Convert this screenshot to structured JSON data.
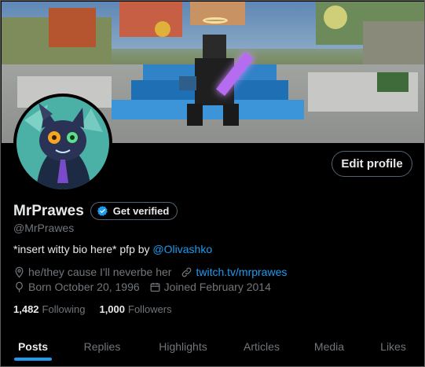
{
  "profile": {
    "edit_profile_label": "Edit profile",
    "display_name": "MrPrawes",
    "verify_label": "Get verified",
    "handle": "@MrPrawes",
    "bio_text": "*insert witty bio here* pfp by ",
    "bio_mention": "@Olivashko",
    "pronouns": "he/they cause I'll neverbe her",
    "website": "twitch.tv/mrprawes",
    "born": "Born October 20, 1996",
    "joined": "Joined February 2014",
    "following_count": "1,482",
    "following_label": "Following",
    "followers_count": "1,000",
    "followers_label": "Followers"
  },
  "tabs": [
    {
      "label": "Posts",
      "active": true
    },
    {
      "label": "Replies",
      "active": false
    },
    {
      "label": "Highlights",
      "active": false
    },
    {
      "label": "Articles",
      "active": false
    },
    {
      "label": "Media",
      "active": false
    },
    {
      "label": "Likes",
      "active": false
    }
  ],
  "colors": {
    "accent": "#1d9bf0",
    "muted": "#71767b",
    "text": "#e7e9ea",
    "border": "#536471"
  }
}
